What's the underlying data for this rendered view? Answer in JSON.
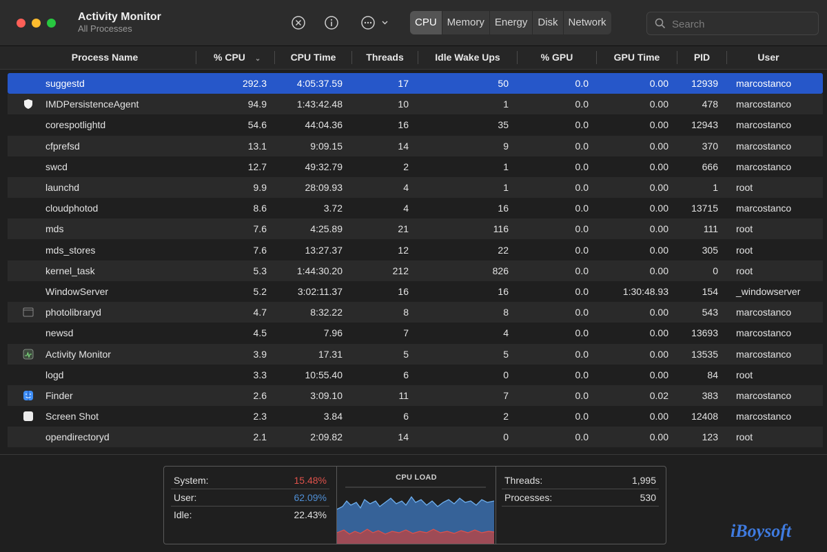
{
  "app": {
    "title": "Activity Monitor",
    "subtitle": "All Processes"
  },
  "toolbar": {
    "icons": [
      "stop-process-icon",
      "info-icon",
      "more-actions-icon"
    ],
    "tabs": [
      "CPU",
      "Memory",
      "Energy",
      "Disk",
      "Network"
    ],
    "active_tab": "CPU",
    "search_placeholder": "Search"
  },
  "columns": {
    "name": "Process Name",
    "cpu": "% CPU",
    "cputime": "CPU Time",
    "threads": "Threads",
    "idle": "Idle Wake Ups",
    "gpu": "% GPU",
    "gputime": "GPU Time",
    "pid": "PID",
    "user": "User"
  },
  "processes": [
    {
      "name": "suggestd",
      "cpu": "292.3",
      "cputime": "4:05:37.59",
      "threads": "17",
      "idle": "50",
      "gpu": "0.0",
      "gputime": "0.00",
      "pid": "12939",
      "user": "marcostanco",
      "icon": ""
    },
    {
      "name": "IMDPersistenceAgent",
      "cpu": "94.9",
      "cputime": "1:43:42.48",
      "threads": "10",
      "idle": "1",
      "gpu": "0.0",
      "gputime": "0.00",
      "pid": "478",
      "user": "marcostanco",
      "icon": "shield-icon"
    },
    {
      "name": "corespotlightd",
      "cpu": "54.6",
      "cputime": "44:04.36",
      "threads": "16",
      "idle": "35",
      "gpu": "0.0",
      "gputime": "0.00",
      "pid": "12943",
      "user": "marcostanco",
      "icon": ""
    },
    {
      "name": "cfprefsd",
      "cpu": "13.1",
      "cputime": "9:09.15",
      "threads": "14",
      "idle": "9",
      "gpu": "0.0",
      "gputime": "0.00",
      "pid": "370",
      "user": "marcostanco",
      "icon": ""
    },
    {
      "name": "swcd",
      "cpu": "12.7",
      "cputime": "49:32.79",
      "threads": "2",
      "idle": "1",
      "gpu": "0.0",
      "gputime": "0.00",
      "pid": "666",
      "user": "marcostanco",
      "icon": ""
    },
    {
      "name": "launchd",
      "cpu": "9.9",
      "cputime": "28:09.93",
      "threads": "4",
      "idle": "1",
      "gpu": "0.0",
      "gputime": "0.00",
      "pid": "1",
      "user": "root",
      "icon": ""
    },
    {
      "name": "cloudphotod",
      "cpu": "8.6",
      "cputime": "3.72",
      "threads": "4",
      "idle": "16",
      "gpu": "0.0",
      "gputime": "0.00",
      "pid": "13715",
      "user": "marcostanco",
      "icon": ""
    },
    {
      "name": "mds",
      "cpu": "7.6",
      "cputime": "4:25.89",
      "threads": "21",
      "idle": "116",
      "gpu": "0.0",
      "gputime": "0.00",
      "pid": "111",
      "user": "root",
      "icon": ""
    },
    {
      "name": "mds_stores",
      "cpu": "7.6",
      "cputime": "13:27.37",
      "threads": "12",
      "idle": "22",
      "gpu": "0.0",
      "gputime": "0.00",
      "pid": "305",
      "user": "root",
      "icon": ""
    },
    {
      "name": "kernel_task",
      "cpu": "5.3",
      "cputime": "1:44:30.20",
      "threads": "212",
      "idle": "826",
      "gpu": "0.0",
      "gputime": "0.00",
      "pid": "0",
      "user": "root",
      "icon": ""
    },
    {
      "name": "WindowServer",
      "cpu": "5.2",
      "cputime": "3:02:11.37",
      "threads": "16",
      "idle": "16",
      "gpu": "0.0",
      "gputime": "1:30:48.93",
      "pid": "154",
      "user": "_windowserver",
      "icon": ""
    },
    {
      "name": "photolibraryd",
      "cpu": "4.7",
      "cputime": "8:32.22",
      "threads": "8",
      "idle": "8",
      "gpu": "0.0",
      "gputime": "0.00",
      "pid": "543",
      "user": "marcostanco",
      "icon": "window-icon"
    },
    {
      "name": "newsd",
      "cpu": "4.5",
      "cputime": "7.96",
      "threads": "7",
      "idle": "4",
      "gpu": "0.0",
      "gputime": "0.00",
      "pid": "13693",
      "user": "marcostanco",
      "icon": ""
    },
    {
      "name": "Activity Monitor",
      "cpu": "3.9",
      "cputime": "17.31",
      "threads": "5",
      "idle": "5",
      "gpu": "0.0",
      "gputime": "0.00",
      "pid": "13535",
      "user": "marcostanco",
      "icon": "activity-monitor-icon"
    },
    {
      "name": "logd",
      "cpu": "3.3",
      "cputime": "10:55.40",
      "threads": "6",
      "idle": "0",
      "gpu": "0.0",
      "gputime": "0.00",
      "pid": "84",
      "user": "root",
      "icon": ""
    },
    {
      "name": "Finder",
      "cpu": "2.6",
      "cputime": "3:09.10",
      "threads": "11",
      "idle": "7",
      "gpu": "0.0",
      "gputime": "0.02",
      "pid": "383",
      "user": "marcostanco",
      "icon": "finder-icon"
    },
    {
      "name": "Screen Shot",
      "cpu": "2.3",
      "cputime": "3.84",
      "threads": "6",
      "idle": "2",
      "gpu": "0.0",
      "gputime": "0.00",
      "pid": "12408",
      "user": "marcostanco",
      "icon": "screenshot-icon"
    },
    {
      "name": "opendirectoryd",
      "cpu": "2.1",
      "cputime": "2:09.82",
      "threads": "14",
      "idle": "0",
      "gpu": "0.0",
      "gputime": "0.00",
      "pid": "123",
      "user": "root",
      "icon": ""
    }
  ],
  "summary": {
    "system_label": "System:",
    "system_value": "15.48%",
    "user_label": "User:",
    "user_value": "62.09%",
    "idle_label": "Idle:",
    "idle_value": "22.43%",
    "chart_title": "CPU LOAD",
    "threads_label": "Threads:",
    "threads_value": "1,995",
    "processes_label": "Processes:",
    "processes_value": "530"
  },
  "colors": {
    "system": "#e0524b",
    "user": "#4f8fd6",
    "selection": "#2657c9",
    "logo": "#3f7be0"
  },
  "watermark": "iBoysoft"
}
